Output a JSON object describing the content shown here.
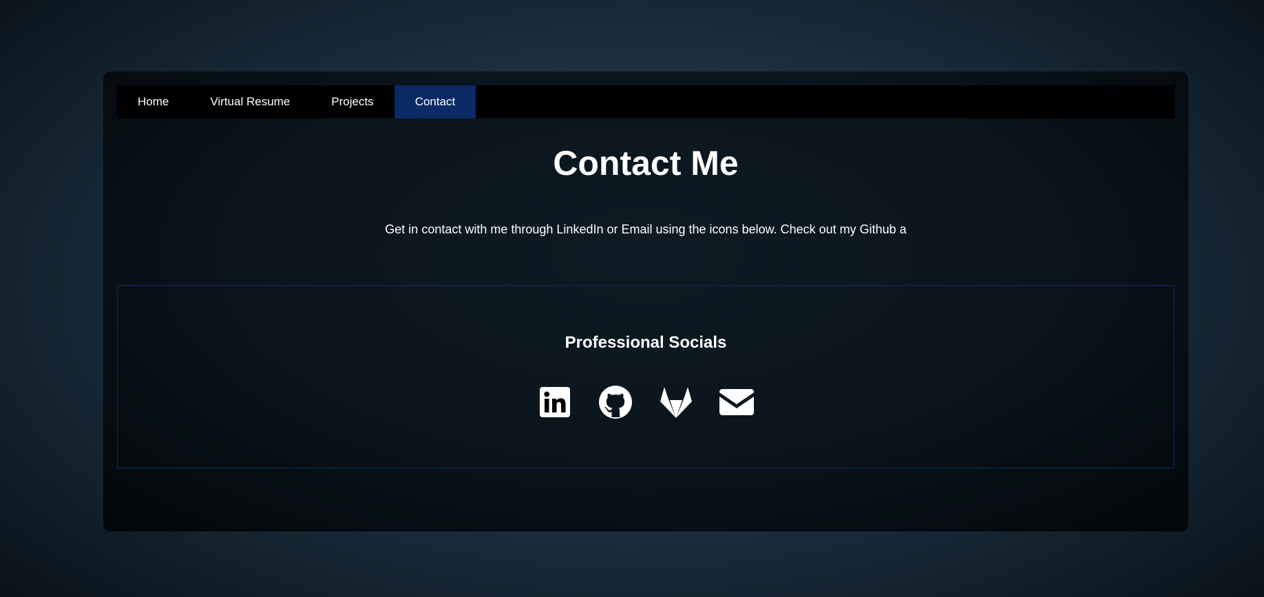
{
  "nav": {
    "items": [
      {
        "label": "Home",
        "active": false
      },
      {
        "label": "Virtual Resume",
        "active": false
      },
      {
        "label": "Projects",
        "active": false
      },
      {
        "label": "Contact",
        "active": true
      }
    ]
  },
  "main": {
    "title": "Contact Me",
    "intro": "Get in contact with me through LinkedIn or Email using the icons below. Check out my Github a"
  },
  "socials": {
    "heading": "Professional Socials",
    "icons": [
      "linkedin-icon",
      "github-icon",
      "gitlab-icon",
      "email-icon"
    ]
  },
  "colors": {
    "active_tab": "#0a2a66",
    "border": "#0d2a63",
    "text": "#ffffff",
    "navbar": "#000000"
  }
}
